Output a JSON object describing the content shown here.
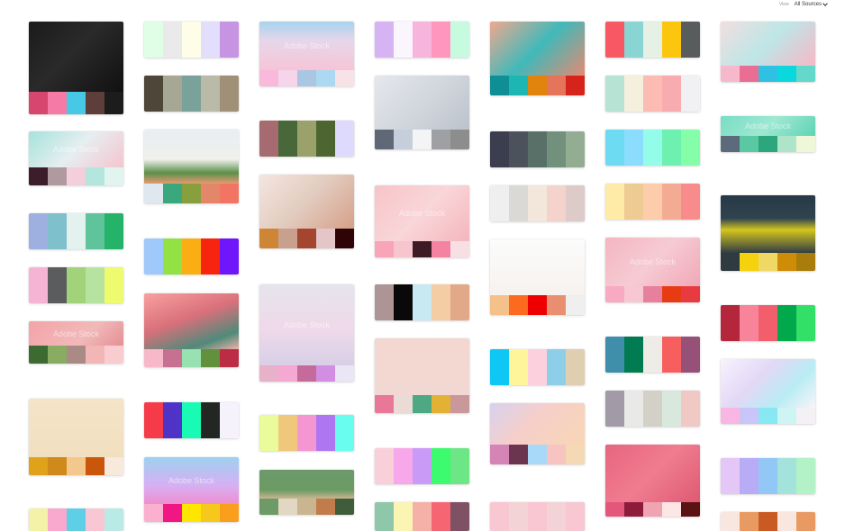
{
  "toolbar": {
    "view_label": "View",
    "source_value": "All Sources"
  },
  "watermark": "Adobe Stock",
  "columns": [
    [
      {
        "kind": "image",
        "name": "gshock-watch",
        "img": "linear-gradient(135deg,#1b1b1b 0%,#2a2a2a 45%,#111 100%)",
        "colors": [
          "#d6466f",
          "#f57aa6",
          "#47c9e5",
          "#5d3e3a",
          "#1c1c1c"
        ]
      },
      {
        "kind": "image",
        "name": "pastel-mint-pink",
        "img": "linear-gradient(135deg,#a5e3db 0%,#e6eef0 50%,#f4c5cf 100%)",
        "colors": [
          "#3c1d2a",
          "#b19a9f",
          "#f3cfdc",
          "#b5e6de",
          "#e1f4f0"
        ]
      },
      {
        "kind": "colors",
        "name": "blue-green",
        "colors": [
          "#9eb0e0",
          "#7ec0cb",
          "#e3f2ee",
          "#5fc49b",
          "#25b36a"
        ]
      },
      {
        "kind": "colors",
        "name": "pink-gray-lime",
        "colors": [
          "#f6b4d4",
          "#5a5c5d",
          "#a2d27a",
          "#b6e3a0",
          "#eefb6e"
        ]
      },
      {
        "kind": "image",
        "name": "monstera-leaf",
        "img": "linear-gradient(135deg,#f4a3a8 0%,#f1b9b9 60%,#e58f95 100%)",
        "colors": [
          "#3c6a30",
          "#88ad62",
          "#a98a84",
          "#f2b6b7",
          "#f9cdd0"
        ]
      },
      {
        "kind": "image",
        "name": "honey-bottles",
        "img": "linear-gradient(180deg,#f5e4c7 0%,#f1dfc0 100%)",
        "colors": [
          "#e0a21a",
          "#d0891b",
          "#f4c88c",
          "#c9560a",
          "#f7e9dc"
        ]
      },
      {
        "kind": "colors",
        "name": "pastel-rainbow",
        "colors": [
          "#f4f1a8",
          "#f8a9cd",
          "#5ecfe7",
          "#f9c6d4",
          "#b9eae5"
        ]
      }
    ],
    [
      {
        "kind": "colors",
        "name": "soft-pastels",
        "colors": [
          "#e0fde5",
          "#ebeaea",
          "#fefee8",
          "#e3defc",
          "#c794e3"
        ]
      },
      {
        "kind": "colors",
        "name": "earthy-grays",
        "colors": [
          "#4e4638",
          "#a7a796",
          "#7aa19a",
          "#babaa8",
          "#9f9077"
        ]
      },
      {
        "kind": "image",
        "name": "white-building",
        "img": "linear-gradient(180deg,#e8eef2 0%,#f0f0ec 55%,#5a8f49 80%,#e89a72 100%)",
        "colors": [
          "#dfe7ef",
          "#3aa77d",
          "#889f3e",
          "#e48669",
          "#f27563"
        ]
      },
      {
        "kind": "colors",
        "name": "vivid-rainbow",
        "colors": [
          "#9fc8fb",
          "#92e245",
          "#fbad14",
          "#f7240f",
          "#6f16fa"
        ]
      },
      {
        "kind": "image",
        "name": "pink-room",
        "img": "linear-gradient(160deg,#f8a0a0 0%,#d9707a 45%,#4f8a7a 80%,#f0b0a8 100%)",
        "colors": [
          "#f7b9c9",
          "#c67092",
          "#98e1b0",
          "#62903d",
          "#bc2c44"
        ]
      },
      {
        "kind": "colors",
        "name": "red-violet-dark",
        "colors": [
          "#f53a4a",
          "#4e33c6",
          "#19fab4",
          "#222724",
          "#f6f2fb"
        ]
      },
      {
        "kind": "image",
        "name": "ice-cream-cones",
        "img": "linear-gradient(180deg,#9ed1f0 0%,#d6b0f4 60%,#ef8fcf 100%)",
        "colors": [
          "#fbb0d0",
          "#f01784",
          "#ffe600",
          "#f6c81b",
          "#fa9f1b"
        ]
      }
    ],
    [
      {
        "kind": "image",
        "name": "pastel-sky",
        "img": "linear-gradient(180deg,#a8d3ef 0%,#e7d6ea 40%,#f6c4d6 100%)",
        "colors": [
          "#f9b9da",
          "#f6d4ea",
          "#a9c6e3",
          "#acd9f1",
          "#f8e2e7"
        ]
      },
      {
        "kind": "colors",
        "name": "olive-rose",
        "colors": [
          "#a56b70",
          "#48683a",
          "#9aa16a",
          "#4d6631",
          "#dedafd"
        ]
      },
      {
        "kind": "image",
        "name": "woman-magnifier",
        "img": "linear-gradient(135deg,#f4e6e1 0%,#e2cbbe 50%,#d6a089 100%)",
        "colors": [
          "#cf8536",
          "#c8a08d",
          "#a54530",
          "#e4c5c8",
          "#2e0406"
        ]
      },
      {
        "kind": "image",
        "name": "pink-cloud-frame",
        "img": "linear-gradient(180deg,#e6e4ec 0%,#efd9ea 55%,#d8cfe6 100%)",
        "colors": [
          "#e8b1ca",
          "#f5a8d2",
          "#c56b9c",
          "#d28ee2",
          "#eae6f5"
        ]
      },
      {
        "kind": "colors",
        "name": "lime-violet-cyan",
        "colors": [
          "#eafb9b",
          "#f0c87c",
          "#f496d2",
          "#ae76f0",
          "#69fdef"
        ]
      },
      {
        "kind": "image",
        "name": "green-lamp-room",
        "img": "linear-gradient(180deg,#6d9a6a 0%,#6b9b63 70%,#c9b58f 100%)",
        "colors": [
          "#6d9a66",
          "#e1d7c3",
          "#c9b58f",
          "#c27c4b",
          "#3f5d3a"
        ]
      }
    ],
    [
      {
        "kind": "colors",
        "name": "lilac-pink-mint",
        "colors": [
          "#d6b4f4",
          "#fbf5fd",
          "#f7b4dc",
          "#fe96bd",
          "#c6fbe0"
        ]
      },
      {
        "kind": "image",
        "name": "business-cards",
        "img": "linear-gradient(135deg,#e5e8ec 0%,#d0d5dc 55%,#bcc3cc 100%)",
        "colors": [
          "#5e6876",
          "#c7cedb",
          "#f4f4f6",
          "#9ea0a4",
          "#8d8d8d"
        ]
      },
      {
        "kind": "image",
        "name": "pink-marble",
        "img": "linear-gradient(135deg,#f7c4c8 0%,#f9d6d8 50%,#f4b6bd 100%)",
        "colors": [
          "#f8a4b9",
          "#f7c5ce",
          "#3e1a25",
          "#f383a0",
          "#f7e0e4"
        ]
      },
      {
        "kind": "colors",
        "name": "taupe-black-peach",
        "colors": [
          "#ad9596",
          "#090909",
          "#c8e9f1",
          "#f4cda4",
          "#e1a987"
        ]
      },
      {
        "kind": "image",
        "name": "framed-art",
        "img": "linear-gradient(180deg,#f3d7d0 0%,#f2d8d2 100%)",
        "colors": [
          "#e97798",
          "#eadbd6",
          "#4ea883",
          "#e3b234",
          "#c9989b"
        ]
      },
      {
        "kind": "colors",
        "name": "pink-violet-green",
        "colors": [
          "#f9d0d9",
          "#f7a8ea",
          "#ca9af7",
          "#3cfb6e",
          "#6de685"
        ]
      },
      {
        "kind": "colors",
        "name": "sage-butter-coral",
        "colors": [
          "#8fc7aa",
          "#fbf5b4",
          "#f5b1a8",
          "#f66672",
          "#7f5164"
        ]
      }
    ],
    [
      {
        "kind": "image",
        "name": "tiled-building",
        "img": "linear-gradient(135deg,#f1a88e 0%,#40b9ba 50%,#e58a72 100%)",
        "colors": [
          "#0f8f95",
          "#1db6b3",
          "#e1840e",
          "#e4755a",
          "#d6231c"
        ]
      },
      {
        "kind": "colors",
        "name": "slate-greens",
        "colors": [
          "#3c3d4e",
          "#4b525c",
          "#587068",
          "#71917d",
          "#93ad92"
        ]
      },
      {
        "kind": "colors",
        "name": "neutral-blush",
        "colors": [
          "#efefef",
          "#dad9d6",
          "#f3e7dc",
          "#f4d3cd",
          "#dccbc8"
        ]
      },
      {
        "kind": "image",
        "name": "three-women",
        "img": "linear-gradient(180deg,#fcfcfc 0%,#f6f2ee 100%)",
        "colors": [
          "#f5c18a",
          "#fb6a1e",
          "#ee0000",
          "#ea8e72",
          "#efefef"
        ]
      },
      {
        "kind": "colors",
        "name": "cyan-yellow-pink",
        "colors": [
          "#0ec7f5",
          "#fef59a",
          "#fcd0dc",
          "#8dcfe8",
          "#dfcfb0"
        ]
      },
      {
        "kind": "image",
        "name": "sunset-clouds",
        "img": "linear-gradient(135deg,#d8d1ef 0%,#f6cfc9 45%,#f7d6b4 100%)",
        "colors": [
          "#d584b6",
          "#6b3550",
          "#a9d9f8",
          "#f7c4c1",
          "#f5d8b4"
        ]
      },
      {
        "kind": "image",
        "name": "pink-sky-partial",
        "img": "linear-gradient(180deg,#f8c7d2 0%,#f3d3d6 100%)",
        "colors": [
          "#f8c7d2",
          "#f3d3d6",
          "#f8c7d2",
          "#f3d3d6",
          "#f8c7d2"
        ]
      }
    ],
    [
      {
        "kind": "colors",
        "name": "coral-teal-gold",
        "colors": [
          "#f85864",
          "#89d5d3",
          "#e6f1e6",
          "#fcc60e",
          "#595c5c"
        ]
      },
      {
        "kind": "colors",
        "name": "mint-peach",
        "colors": [
          "#b6e3d4",
          "#f5f0dd",
          "#fcbbb3",
          "#f9acaf",
          "#f1f1f3"
        ]
      },
      {
        "kind": "colors",
        "name": "aqua-greens",
        "colors": [
          "#6ddcf2",
          "#8bdcfd",
          "#93fde9",
          "#6ef1b0",
          "#85fea9"
        ]
      },
      {
        "kind": "colors",
        "name": "butter-salmon",
        "colors": [
          "#fdeba7",
          "#eecb93",
          "#fdcdab",
          "#f4ab93",
          "#f88c8c"
        ]
      },
      {
        "kind": "image",
        "name": "pink-marble-2",
        "img": "linear-gradient(135deg,#f3b6c1 0%,#f6cbd3 50%,#f0a8b6 100%)",
        "colors": [
          "#f8aac2",
          "#f7c7d4",
          "#e7809d",
          "#e73c13",
          "#e83b41"
        ]
      },
      {
        "kind": "colors",
        "name": "teal-green-rose",
        "colors": [
          "#3f8fab",
          "#027a52",
          "#edece6",
          "#f75f5e",
          "#955178"
        ]
      },
      {
        "kind": "colors",
        "name": "mauve-gray-sage",
        "colors": [
          "#a29aa6",
          "#e9e9e7",
          "#d3d0c7",
          "#d9e8dd",
          "#f0c9c5"
        ]
      },
      {
        "kind": "image",
        "name": "pink-jars",
        "img": "linear-gradient(135deg,#e7657f 0%,#f07c90 50%,#de5a72 100%)",
        "colors": [
          "#e4577a",
          "#8e1b3c",
          "#f0a3b1",
          "#fde7e6",
          "#5a1312"
        ]
      }
    ],
    [
      {
        "kind": "image",
        "name": "umbrellas",
        "img": "linear-gradient(135deg,#f2dee0 0%,#bde6e6 50%,#f5b9c6 100%)",
        "colors": [
          "#f6b9cc",
          "#ea6d94",
          "#2ec1e3",
          "#0ad8dd",
          "#64d8c9"
        ]
      },
      {
        "kind": "image",
        "name": "mint-palm-leaves",
        "img": "linear-gradient(135deg,#79dcc4 0%,#9ee8d2 50%,#5fd3b5 100%)",
        "colors": [
          "#5b6b7c",
          "#5ac8a3",
          "#2ca77c",
          "#aee5ca",
          "#f0f7d8"
        ]
      },
      {
        "kind": "image",
        "name": "yellow-tree",
        "img": "linear-gradient(180deg,#283846 0%,#2f4450 40%,#d4c51d 60%,#313d44 100%)",
        "colors": [
          "#2f3a41",
          "#f6d20e",
          "#efd863",
          "#cf8c06",
          "#a97c0c"
        ]
      },
      {
        "kind": "colors",
        "name": "crimson-green",
        "colors": [
          "#b3263c",
          "#f8849a",
          "#f35e6d",
          "#01a84c",
          "#32df67"
        ]
      },
      {
        "kind": "image",
        "name": "pastel-feather",
        "img": "linear-gradient(135deg,#f8f2fd 0%,#e2d8f6 40%,#b8ecf4 70%,#f7f5f8 100%)",
        "colors": [
          "#f8b7e3",
          "#c9c5f8",
          "#87e7f3",
          "#cef4f3",
          "#f4f1f5"
        ]
      },
      {
        "kind": "colors",
        "name": "lavender-aqua",
        "colors": [
          "#e5c7f7",
          "#b8acf6",
          "#92c7f6",
          "#a3e3db",
          "#b3f1c7"
        ]
      },
      {
        "kind": "image",
        "name": "redhead-partial",
        "img": "linear-gradient(180deg,#f9e7df 0%,#e89a62 60%,#c95a24 100%)",
        "colors": [
          "#f9e7df",
          "#e89a62",
          "#c95a24",
          "#f9e7df",
          "#e89a62"
        ]
      }
    ]
  ]
}
